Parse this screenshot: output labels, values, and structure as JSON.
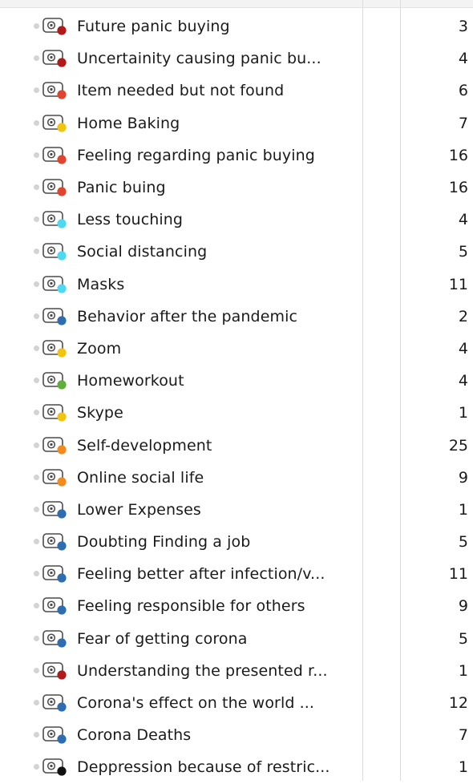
{
  "colors": {
    "darkred": "#b01a1a",
    "red": "#e0442f",
    "yellow": "#f2c40f",
    "cyan": "#4ed8f2",
    "blue": "#2f6db1",
    "green": "#5fae3a",
    "orange": "#f28a1e",
    "black": "#111111"
  },
  "codes": [
    {
      "label": "Future panic buying",
      "count": "3",
      "color": "darkred"
    },
    {
      "label": "Uncertainity causing panic bu...",
      "count": "4",
      "color": "darkred"
    },
    {
      "label": "Item needed but not found",
      "count": "6",
      "color": "red"
    },
    {
      "label": "Home Baking",
      "count": "7",
      "color": "yellow"
    },
    {
      "label": "Feeling regarding panic buying",
      "count": "16",
      "color": "red"
    },
    {
      "label": "Panic buing",
      "count": "16",
      "color": "red"
    },
    {
      "label": "Less touching",
      "count": "4",
      "color": "cyan"
    },
    {
      "label": "Social distancing",
      "count": "5",
      "color": "cyan"
    },
    {
      "label": "Masks",
      "count": "11",
      "color": "cyan"
    },
    {
      "label": "Behavior after the pandemic",
      "count": "2",
      "color": "blue"
    },
    {
      "label": "Zoom",
      "count": "4",
      "color": "yellow"
    },
    {
      "label": "Homeworkout",
      "count": "4",
      "color": "green"
    },
    {
      "label": "Skype",
      "count": "1",
      "color": "yellow"
    },
    {
      "label": "Self-development",
      "count": "25",
      "color": "orange"
    },
    {
      "label": "Online social life",
      "count": "9",
      "color": "orange"
    },
    {
      "label": "Lower Expenses",
      "count": "1",
      "color": "blue"
    },
    {
      "label": "Doubting Finding a job",
      "count": "5",
      "color": "blue"
    },
    {
      "label": "Feeling better after infection/v...",
      "count": "11",
      "color": "blue"
    },
    {
      "label": "Feeling responsible for others",
      "count": "9",
      "color": "blue"
    },
    {
      "label": "Fear of getting corona",
      "count": "5",
      "color": "blue"
    },
    {
      "label": "Understanding the presented r...",
      "count": "1",
      "color": "darkred"
    },
    {
      "label": "Corona's effect on the world ...",
      "count": "12",
      "color": "blue"
    },
    {
      "label": "Corona Deaths",
      "count": "7",
      "color": "blue"
    },
    {
      "label": "Deppression because of restric...",
      "count": "1",
      "color": "black"
    }
  ]
}
